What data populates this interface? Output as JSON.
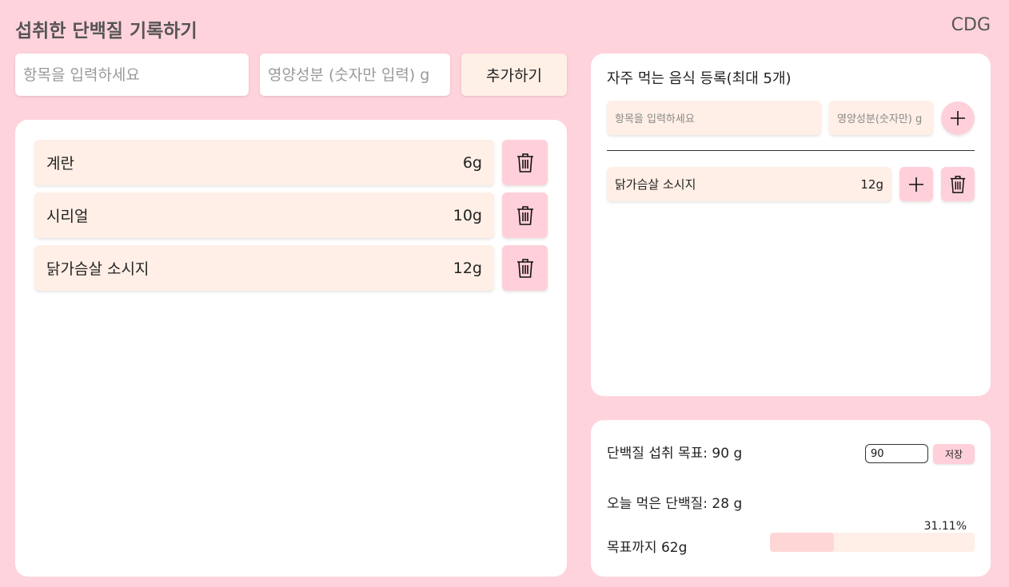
{
  "header": {
    "title": "섭취한 단백질 기록하기",
    "user": "CDG"
  },
  "entry_form": {
    "item_placeholder": "항목을 입력하세요",
    "nutrient_placeholder": "영양성분 (숫자만 입력) g",
    "add_label": "추가하기"
  },
  "entries": [
    {
      "name": "계란",
      "amount": "6g"
    },
    {
      "name": "시리얼",
      "amount": "10g"
    },
    {
      "name": "닭가슴살 소시지",
      "amount": "12g"
    }
  ],
  "favorites": {
    "title": "자주 먹는 음식 등록(최대 5개)",
    "item_placeholder": "항목을 입력하세요",
    "nutrient_placeholder": "영양성분(숫자만) g",
    "items": [
      {
        "name": "닭가슴살 소시지",
        "amount": "12g"
      }
    ]
  },
  "goal": {
    "goal_text": "단백질 섭취 목표: 90 g",
    "input_value": "90",
    "save_label": "저장",
    "today_text": "오늘 먹은 단백질: 28 g",
    "remaining_text": "목표까지 62g",
    "percent_text": "31.11%",
    "progress_fraction": 0.3111
  },
  "colors": {
    "background": "#ffd3dc",
    "pill": "#ffefe6",
    "accent": "#ffd0d9",
    "progress_fill": "#ffd6d6"
  },
  "icons": {
    "delete": "trash-icon",
    "add": "plus-icon"
  }
}
